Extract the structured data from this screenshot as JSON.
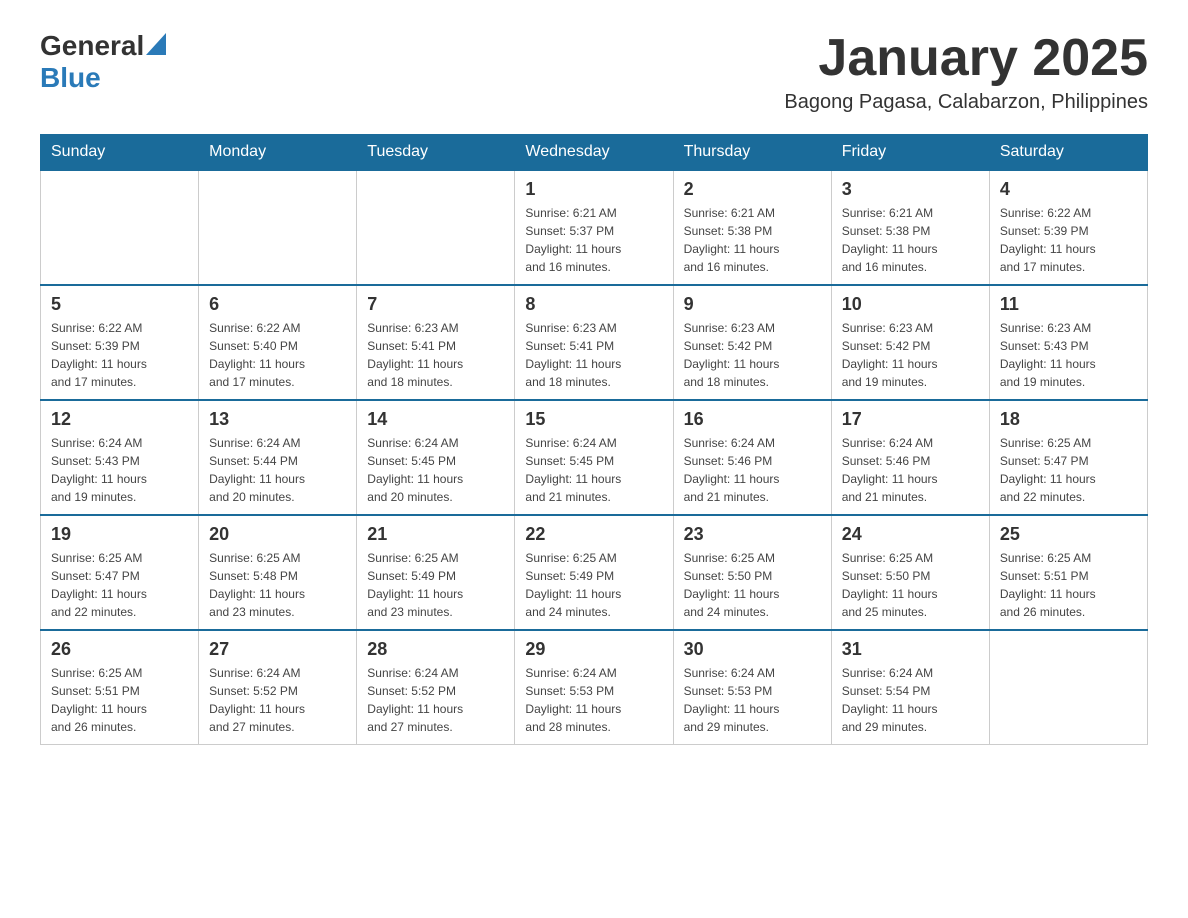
{
  "header": {
    "logo_general": "General",
    "logo_blue": "Blue",
    "title": "January 2025",
    "subtitle": "Bagong Pagasa, Calabarzon, Philippines"
  },
  "days_of_week": [
    "Sunday",
    "Monday",
    "Tuesday",
    "Wednesday",
    "Thursday",
    "Friday",
    "Saturday"
  ],
  "weeks": [
    {
      "days": [
        {
          "num": "",
          "info": ""
        },
        {
          "num": "",
          "info": ""
        },
        {
          "num": "",
          "info": ""
        },
        {
          "num": "1",
          "info": "Sunrise: 6:21 AM\nSunset: 5:37 PM\nDaylight: 11 hours\nand 16 minutes."
        },
        {
          "num": "2",
          "info": "Sunrise: 6:21 AM\nSunset: 5:38 PM\nDaylight: 11 hours\nand 16 minutes."
        },
        {
          "num": "3",
          "info": "Sunrise: 6:21 AM\nSunset: 5:38 PM\nDaylight: 11 hours\nand 16 minutes."
        },
        {
          "num": "4",
          "info": "Sunrise: 6:22 AM\nSunset: 5:39 PM\nDaylight: 11 hours\nand 17 minutes."
        }
      ]
    },
    {
      "days": [
        {
          "num": "5",
          "info": "Sunrise: 6:22 AM\nSunset: 5:39 PM\nDaylight: 11 hours\nand 17 minutes."
        },
        {
          "num": "6",
          "info": "Sunrise: 6:22 AM\nSunset: 5:40 PM\nDaylight: 11 hours\nand 17 minutes."
        },
        {
          "num": "7",
          "info": "Sunrise: 6:23 AM\nSunset: 5:41 PM\nDaylight: 11 hours\nand 18 minutes."
        },
        {
          "num": "8",
          "info": "Sunrise: 6:23 AM\nSunset: 5:41 PM\nDaylight: 11 hours\nand 18 minutes."
        },
        {
          "num": "9",
          "info": "Sunrise: 6:23 AM\nSunset: 5:42 PM\nDaylight: 11 hours\nand 18 minutes."
        },
        {
          "num": "10",
          "info": "Sunrise: 6:23 AM\nSunset: 5:42 PM\nDaylight: 11 hours\nand 19 minutes."
        },
        {
          "num": "11",
          "info": "Sunrise: 6:23 AM\nSunset: 5:43 PM\nDaylight: 11 hours\nand 19 minutes."
        }
      ]
    },
    {
      "days": [
        {
          "num": "12",
          "info": "Sunrise: 6:24 AM\nSunset: 5:43 PM\nDaylight: 11 hours\nand 19 minutes."
        },
        {
          "num": "13",
          "info": "Sunrise: 6:24 AM\nSunset: 5:44 PM\nDaylight: 11 hours\nand 20 minutes."
        },
        {
          "num": "14",
          "info": "Sunrise: 6:24 AM\nSunset: 5:45 PM\nDaylight: 11 hours\nand 20 minutes."
        },
        {
          "num": "15",
          "info": "Sunrise: 6:24 AM\nSunset: 5:45 PM\nDaylight: 11 hours\nand 21 minutes."
        },
        {
          "num": "16",
          "info": "Sunrise: 6:24 AM\nSunset: 5:46 PM\nDaylight: 11 hours\nand 21 minutes."
        },
        {
          "num": "17",
          "info": "Sunrise: 6:24 AM\nSunset: 5:46 PM\nDaylight: 11 hours\nand 21 minutes."
        },
        {
          "num": "18",
          "info": "Sunrise: 6:25 AM\nSunset: 5:47 PM\nDaylight: 11 hours\nand 22 minutes."
        }
      ]
    },
    {
      "days": [
        {
          "num": "19",
          "info": "Sunrise: 6:25 AM\nSunset: 5:47 PM\nDaylight: 11 hours\nand 22 minutes."
        },
        {
          "num": "20",
          "info": "Sunrise: 6:25 AM\nSunset: 5:48 PM\nDaylight: 11 hours\nand 23 minutes."
        },
        {
          "num": "21",
          "info": "Sunrise: 6:25 AM\nSunset: 5:49 PM\nDaylight: 11 hours\nand 23 minutes."
        },
        {
          "num": "22",
          "info": "Sunrise: 6:25 AM\nSunset: 5:49 PM\nDaylight: 11 hours\nand 24 minutes."
        },
        {
          "num": "23",
          "info": "Sunrise: 6:25 AM\nSunset: 5:50 PM\nDaylight: 11 hours\nand 24 minutes."
        },
        {
          "num": "24",
          "info": "Sunrise: 6:25 AM\nSunset: 5:50 PM\nDaylight: 11 hours\nand 25 minutes."
        },
        {
          "num": "25",
          "info": "Sunrise: 6:25 AM\nSunset: 5:51 PM\nDaylight: 11 hours\nand 26 minutes."
        }
      ]
    },
    {
      "days": [
        {
          "num": "26",
          "info": "Sunrise: 6:25 AM\nSunset: 5:51 PM\nDaylight: 11 hours\nand 26 minutes."
        },
        {
          "num": "27",
          "info": "Sunrise: 6:24 AM\nSunset: 5:52 PM\nDaylight: 11 hours\nand 27 minutes."
        },
        {
          "num": "28",
          "info": "Sunrise: 6:24 AM\nSunset: 5:52 PM\nDaylight: 11 hours\nand 27 minutes."
        },
        {
          "num": "29",
          "info": "Sunrise: 6:24 AM\nSunset: 5:53 PM\nDaylight: 11 hours\nand 28 minutes."
        },
        {
          "num": "30",
          "info": "Sunrise: 6:24 AM\nSunset: 5:53 PM\nDaylight: 11 hours\nand 29 minutes."
        },
        {
          "num": "31",
          "info": "Sunrise: 6:24 AM\nSunset: 5:54 PM\nDaylight: 11 hours\nand 29 minutes."
        },
        {
          "num": "",
          "info": ""
        }
      ]
    }
  ]
}
